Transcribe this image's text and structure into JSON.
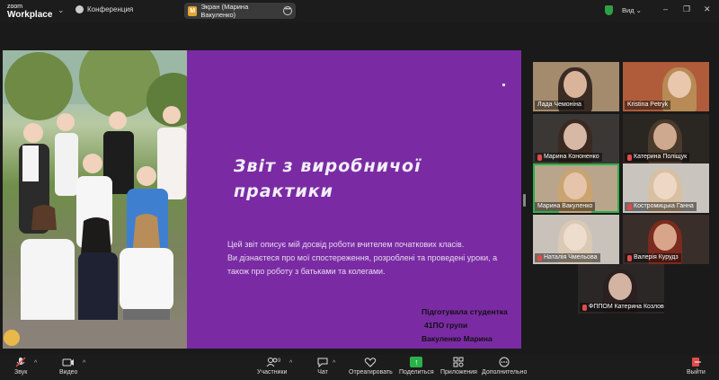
{
  "app": {
    "logo_line1": "zoom",
    "logo_line2": "Workplace"
  },
  "topbar": {
    "conference_label": "Конференция",
    "share_badge": "M",
    "share_label": "Экран (Марина Вакуленко)",
    "view_label": "Вид",
    "window_controls": [
      "–",
      "❐",
      "✕"
    ]
  },
  "slide": {
    "title_line1": "Звіт з виробничої",
    "title_line2": "практики",
    "body_line1": "Цей звіт описує мій досвід роботи вчителем початкових класів.",
    "body_line2": "Ви дізнаєтеся про мої спостереження, розроблені та проведені уроки, а",
    "body_line3": "також про роботу з батьками та колегами.",
    "author_line1": "Підготувала студентка",
    "author_line2": "41ПО групи",
    "author_line3": "Вакуленко Марина"
  },
  "participants": [
    {
      "name": "Лада Чемоніна",
      "muted": false
    },
    {
      "name": "Kristina Petryk",
      "muted": false
    },
    {
      "name": "Марина Кононенко",
      "muted": true
    },
    {
      "name": "Катерина Поліщук",
      "muted": true
    },
    {
      "name": "Марина Вакуленко",
      "muted": false,
      "active": true
    },
    {
      "name": "Костромицька Ганна",
      "muted": true
    },
    {
      "name": "Наталія Чмельова",
      "muted": true
    },
    {
      "name": "Валерія Курудз",
      "muted": true
    },
    {
      "name": "ФППОМ Катерина Козлова",
      "muted": true
    }
  ],
  "toolbar": {
    "audio_label": "Звук",
    "video_label": "Видео",
    "participants_label": "Участники",
    "participants_count": "9",
    "chat_label": "Чат",
    "react_label": "Отреагировать",
    "share_label": "Поделиться",
    "apps_label": "Приложения",
    "more_label": "Дополнительно",
    "leave_label": "Выйти"
  },
  "colors": {
    "slide_bg": "#7a2ba4",
    "active_speaker": "#2ab24a",
    "muted": "#e24a4a",
    "share_green": "#2ab24a"
  }
}
